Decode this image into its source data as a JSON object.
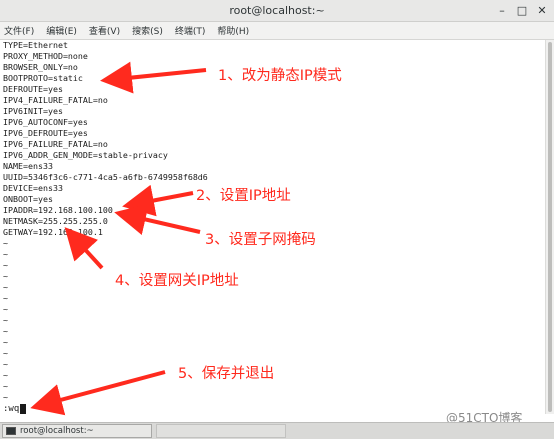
{
  "window": {
    "title": "root@localhost:~",
    "controls": [
      "–",
      "□",
      "✕"
    ]
  },
  "menu": [
    "文件(F)",
    "编辑(E)",
    "查看(V)",
    "搜索(S)",
    "终端(T)",
    "帮助(H)"
  ],
  "terminal": {
    "lines": [
      "TYPE=Ethernet",
      "PROXY_METHOD=none",
      "BROWSER_ONLY=no",
      "BOOTPROTO=static",
      "DEFROUTE=yes",
      "IPV4_FAILURE_FATAL=no",
      "IPV6INIT=yes",
      "IPV6_AUTOCONF=yes",
      "IPV6_DEFROUTE=yes",
      "IPV6_FAILURE_FATAL=no",
      "IPV6_ADDR_GEN_MODE=stable-privacy",
      "NAME=ens33",
      "UUID=5346f3c6-c771-4ca5-a6fb-6749958f68d6",
      "DEVICE=ens33",
      "ONBOOT=yes",
      "IPADDR=192.168.100.100",
      "NETMASK=255.255.255.0",
      "GETWAY=192.168.100.1"
    ],
    "tilde": "~",
    "command": ":wq"
  },
  "annotations": [
    "1、改为静态IP模式",
    "2、设置IP地址",
    "3、设置子网掩码",
    "4、设置网关IP地址",
    "5、保存并退出"
  ],
  "taskbar": {
    "item": "root@localhost:~"
  },
  "watermark": "@51CTO博客",
  "colors": {
    "annotation": "#ff2a1e",
    "titlebar": "#e8e8e7",
    "text": "#1a1a1a"
  }
}
